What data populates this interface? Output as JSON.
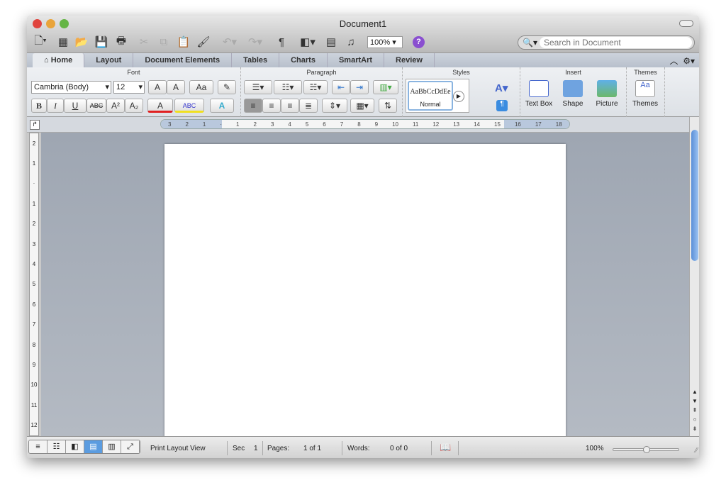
{
  "window": {
    "title": "Document1"
  },
  "toolbar": {
    "zoom": "100%",
    "search_placeholder": "Search in Document",
    "help": "?"
  },
  "tabs": [
    "Home",
    "Layout",
    "Document Elements",
    "Tables",
    "Charts",
    "SmartArt",
    "Review"
  ],
  "ribbon": {
    "font": {
      "label": "Font",
      "name": "Cambria (Body)",
      "size": "12",
      "grow": "A",
      "shrink": "A",
      "change_case": "Aa",
      "bold": "B",
      "italic": "I",
      "underline": "U",
      "strike": "ABC",
      "superscript": "A²",
      "subscript": "A₂",
      "font_color": "A",
      "highlight": "ABC",
      "effects": "A"
    },
    "paragraph": {
      "label": "Paragraph"
    },
    "styles": {
      "label": "Styles",
      "sample": "AaBbCcDdEe",
      "name": "Normal"
    },
    "insert": {
      "label": "Insert",
      "items": [
        "Text Box",
        "Shape",
        "Picture"
      ]
    },
    "themes": {
      "label": "Themes",
      "item": "Themes"
    }
  },
  "ruler": {
    "h": [
      "3",
      "2",
      "1",
      "",
      "1",
      "2",
      "3",
      "4",
      "5",
      "6",
      "7",
      "8",
      "9",
      "10",
      "11",
      "12",
      "13",
      "14",
      "15",
      "16",
      "17",
      "18"
    ],
    "v": [
      "2",
      "1",
      "",
      "1",
      "2",
      "3",
      "4",
      "5",
      "6",
      "7",
      "8",
      "9",
      "10",
      "11",
      "12"
    ]
  },
  "status": {
    "view": "Print Layout View",
    "sec_label": "Sec",
    "sec": "1",
    "pages_label": "Pages:",
    "pages": "1 of 1",
    "words_label": "Words:",
    "words": "0 of 0",
    "zoom": "100%"
  },
  "colors": {
    "accent": "#5b9ce0",
    "font_color": "#e02020",
    "highlight": "#f0e020"
  }
}
